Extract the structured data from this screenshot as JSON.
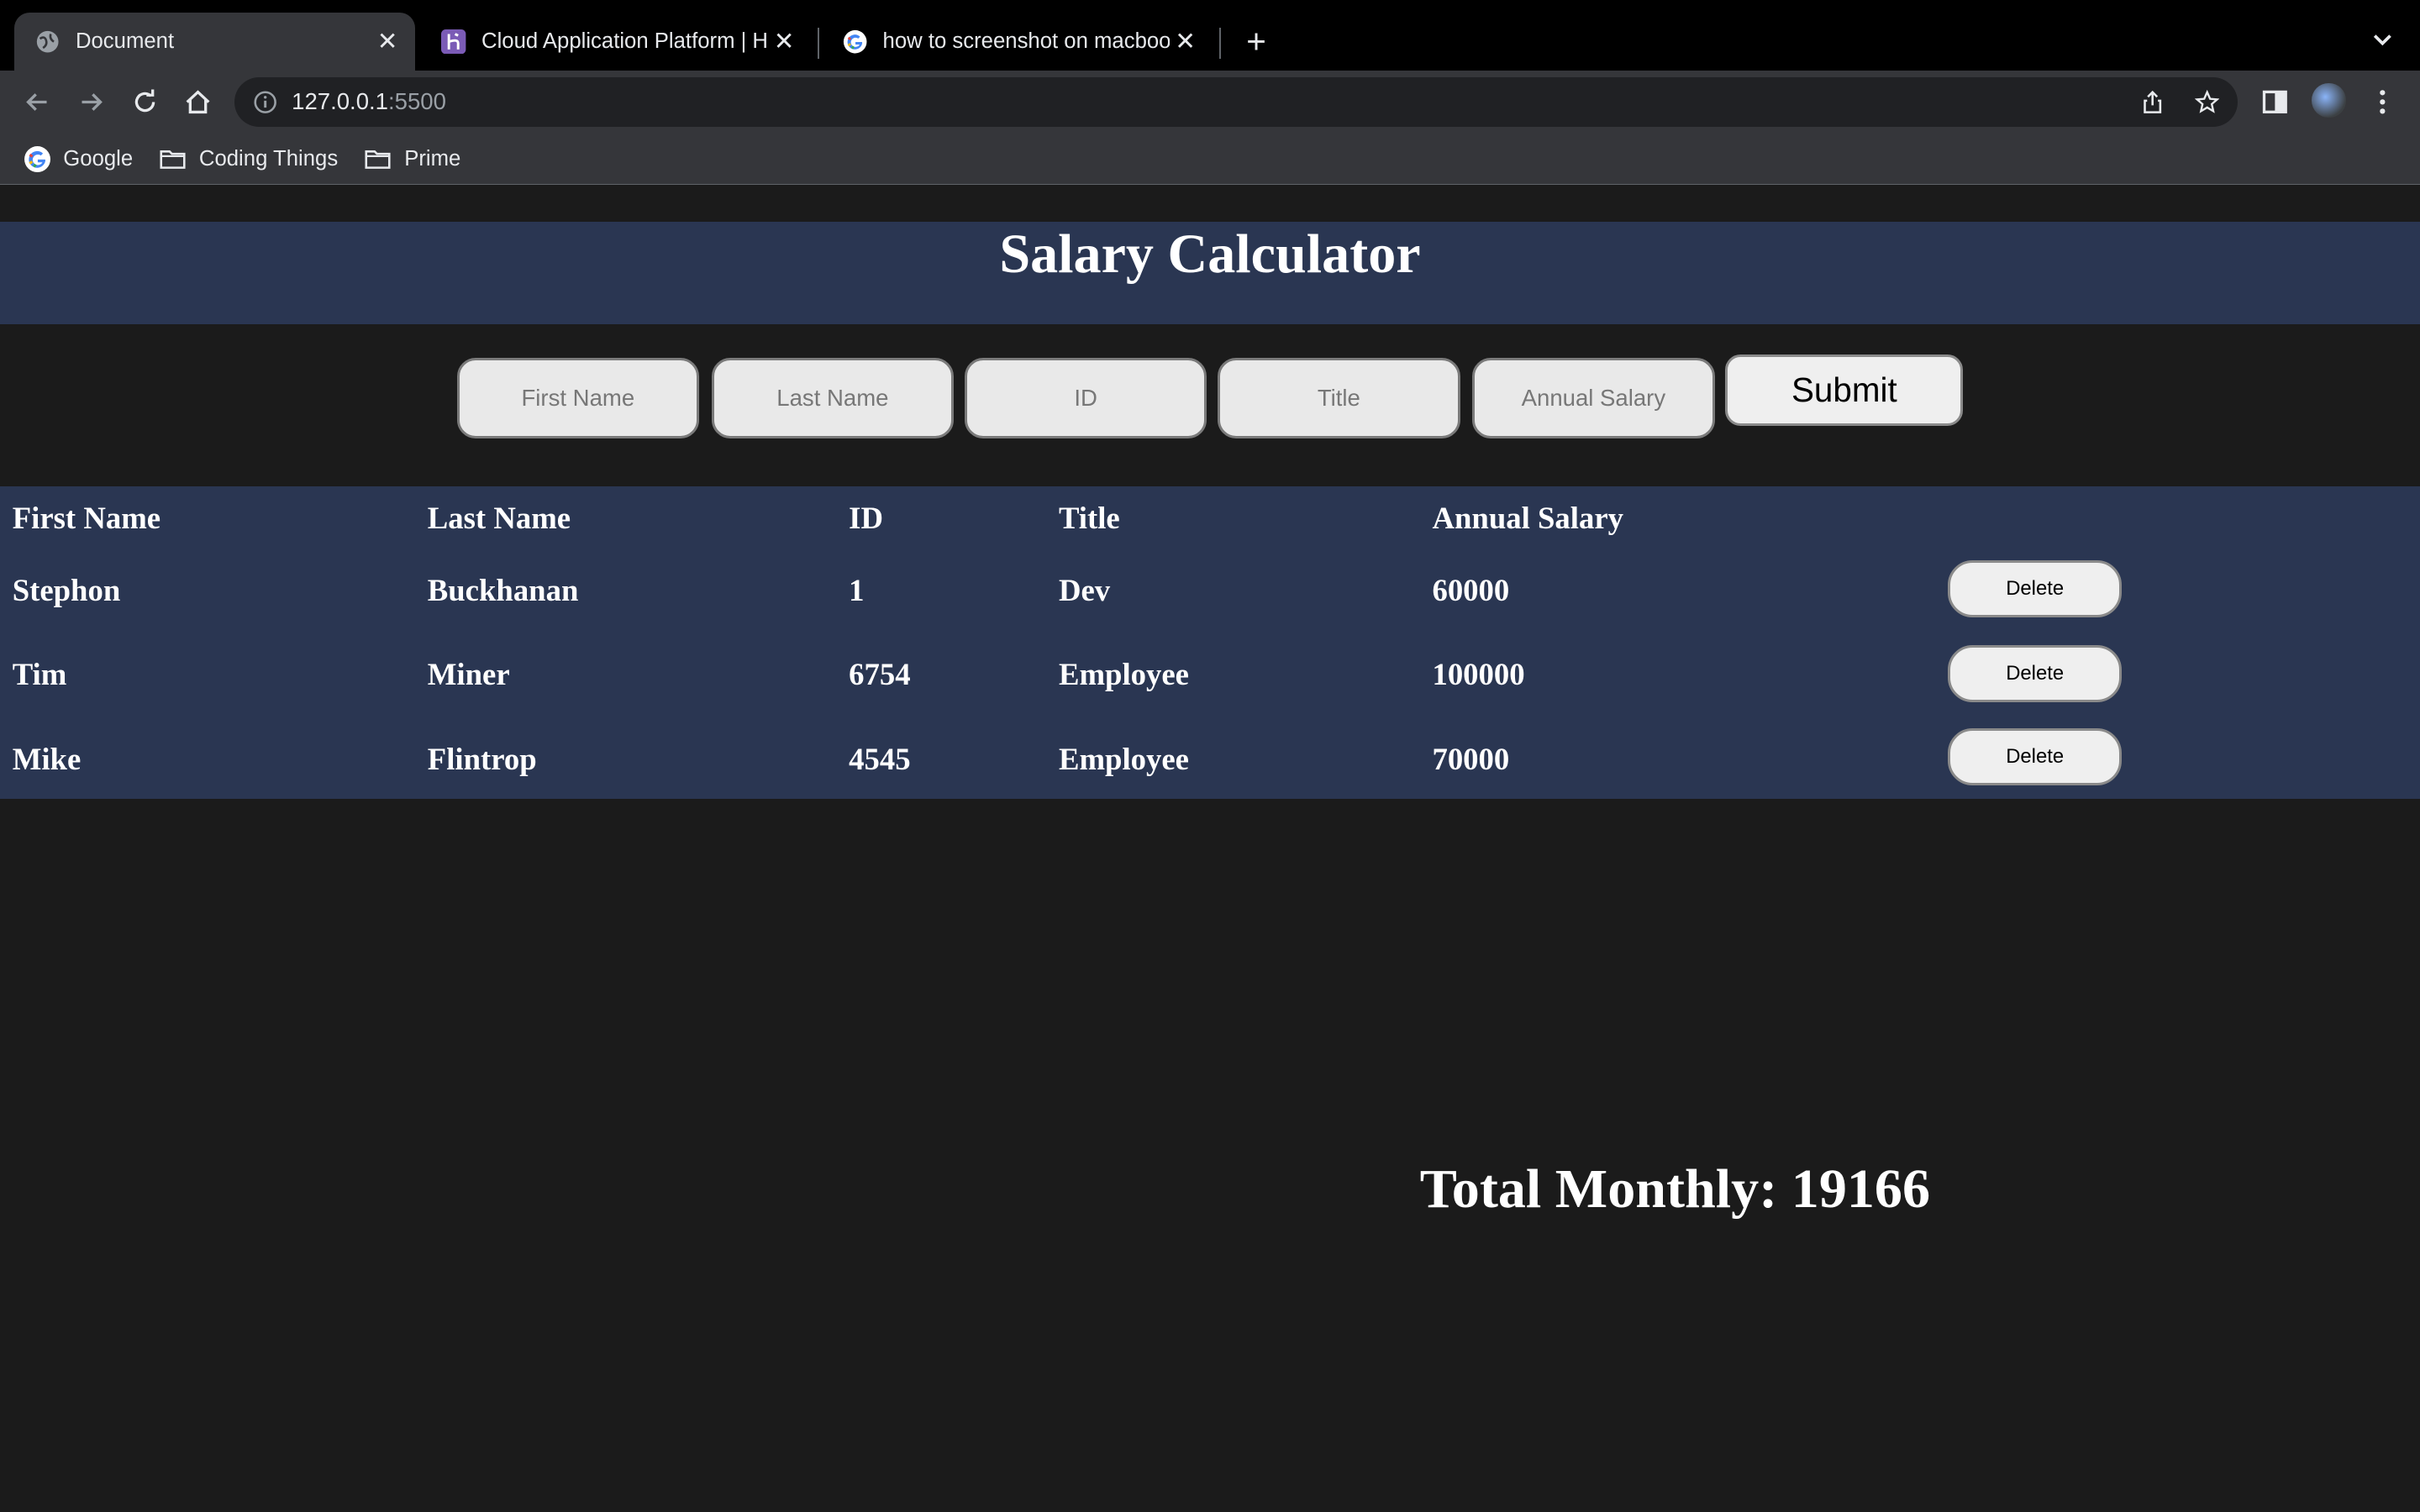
{
  "browser": {
    "tabs": [
      {
        "title": "Document",
        "favicon": "globe-icon",
        "active": true
      },
      {
        "title": "Cloud Application Platform | He",
        "favicon": "heroku-icon",
        "active": false
      },
      {
        "title": "how to screenshot on macbook",
        "favicon": "google-icon",
        "active": false
      }
    ],
    "url_host": "127.0.0.1",
    "url_port": ":5500",
    "bookmarks": [
      {
        "label": "Google",
        "icon": "google-icon"
      },
      {
        "label": "Coding Things",
        "icon": "folder-icon"
      },
      {
        "label": "Prime",
        "icon": "folder-icon"
      }
    ]
  },
  "page": {
    "title": "Salary Calculator",
    "form": {
      "first_name_placeholder": "First Name",
      "last_name_placeholder": "Last Name",
      "id_placeholder": "ID",
      "title_placeholder": "Title",
      "salary_placeholder": "Annual Salary",
      "submit_label": "Submit"
    },
    "table": {
      "headers": [
        "First Name",
        "Last Name",
        "ID",
        "Title",
        "Annual Salary"
      ],
      "rows": [
        {
          "first": "Stephon",
          "last": "Buckhanan",
          "id": "1",
          "title": "Dev",
          "salary": "60000",
          "action": "Delete"
        },
        {
          "first": "Tim",
          "last": "Miner",
          "id": "6754",
          "title": "Employee",
          "salary": "100000",
          "action": "Delete"
        },
        {
          "first": "Mike",
          "last": "Flintrop",
          "id": "4545",
          "title": "Employee",
          "salary": "70000",
          "action": "Delete"
        }
      ]
    },
    "total_monthly": "Total Monthly: 19166"
  },
  "colors": {
    "page_bg": "#1b1b1b",
    "band_bg": "#2a3652",
    "chrome_bg": "#35363a"
  }
}
